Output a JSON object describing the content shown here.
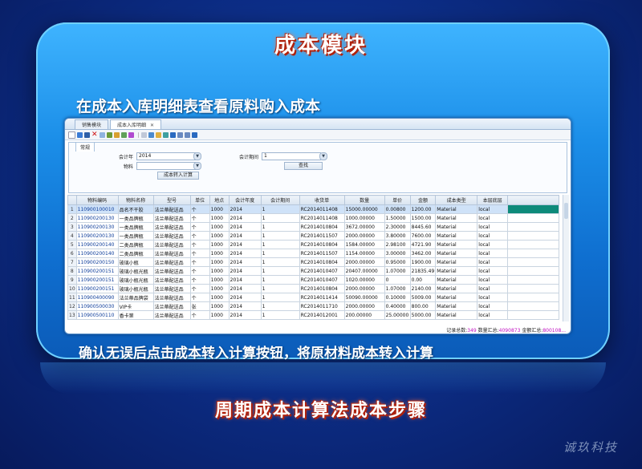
{
  "slide": {
    "title": "成本模块",
    "subtitle": "在成本入库明细表查看原料购入成本",
    "caption": "确认无误后点击成本转入计算按钮，将原材料成本转入计算",
    "bottom_title": "周期成本计算法成本步骤",
    "brand": "诚玖科技"
  },
  "app": {
    "tabs": [
      {
        "label": "销售模块"
      },
      {
        "label": "成本入库明细"
      }
    ],
    "filter_tab": "常规",
    "filters": {
      "fiscal_year_label": "会计年",
      "fiscal_year_value": "2014",
      "fiscal_period_label": "会计期间",
      "fiscal_period_value": "1",
      "material_label": "物料",
      "material_value": "",
      "transfer_button": "成本转入计算",
      "search_button": "查找"
    },
    "table": {
      "columns": [
        "物料编码",
        "物料名称",
        "型号",
        "单位",
        "地点",
        "会计年度",
        "会计期间",
        "收货单",
        "数量",
        "单价",
        "金额",
        "成本类型",
        "本层底层"
      ],
      "rows": [
        [
          "1",
          "110900100010",
          "品名不干胶",
          "法兰蒂配送品",
          "个",
          "1000",
          "2014",
          "1",
          "RC2014011408",
          "15000.00000",
          "0.00800",
          "1200.00",
          "Material",
          "local"
        ],
        [
          "2",
          "110900200130",
          "一类品牌瓶",
          "法兰蒂配送品",
          "个",
          "1000",
          "2014",
          "1",
          "RC2014011408",
          "1000.00000",
          "1.50000",
          "1500.00",
          "Material",
          "local"
        ],
        [
          "3",
          "110900200130",
          "一类品牌瓶",
          "法兰蒂配送品",
          "个",
          "1000",
          "2014",
          "1",
          "RC2014010804",
          "3672.00000",
          "2.30000",
          "8445.60",
          "Material",
          "local"
        ],
        [
          "4",
          "110900200130",
          "一类品牌瓶",
          "法兰蒂配送品",
          "个",
          "1000",
          "2014",
          "1",
          "RC2014011507",
          "2000.00000",
          "3.80000",
          "7600.00",
          "Material",
          "local"
        ],
        [
          "5",
          "110900200140",
          "二类品牌瓶",
          "法兰蒂配送品",
          "个",
          "1000",
          "2014",
          "1",
          "RC2014010804",
          "1584.00000",
          "2.98100",
          "4721.90",
          "Material",
          "local"
        ],
        [
          "6",
          "110900200140",
          "二类品牌瓶",
          "法兰蒂配送品",
          "个",
          "1000",
          "2014",
          "1",
          "RC2014011507",
          "1154.00000",
          "3.00000",
          "3462.00",
          "Material",
          "local"
        ],
        [
          "7",
          "110900200150",
          "玻璃小瓶",
          "法兰蒂配送品",
          "个",
          "1000",
          "2014",
          "1",
          "RC2014010804",
          "2000.00000",
          "0.95000",
          "1900.00",
          "Material",
          "local"
        ],
        [
          "8",
          "110900200151",
          "玻璃小瓶光瓶",
          "法兰蒂配送品",
          "个",
          "1000",
          "2014",
          "1",
          "RC2014010407",
          "20407.00000",
          "1.07000",
          "21835.49",
          "Material",
          "local"
        ],
        [
          "9",
          "110900200151",
          "玻璃小瓶光瓶",
          "法兰蒂配送品",
          "个",
          "1000",
          "2014",
          "1",
          "RC2014010407",
          "1020.00000",
          "0",
          "0.00",
          "Material",
          "local"
        ],
        [
          "10",
          "110900200151",
          "玻璃小瓶光瓶",
          "法兰蒂配送品",
          "个",
          "1000",
          "2014",
          "1",
          "RC2014010804",
          "2000.00000",
          "1.07000",
          "2140.00",
          "Material",
          "local"
        ],
        [
          "11",
          "110900400090",
          "法兰蒂品牌袋",
          "法兰蒂配送品",
          "个",
          "1000",
          "2014",
          "1",
          "RC2014011414",
          "50090.00000",
          "0.10000",
          "5009.00",
          "Material",
          "local"
        ],
        [
          "12",
          "110900500030",
          "VIP卡",
          "法兰蒂配送品",
          "张",
          "1000",
          "2014",
          "1",
          "RC2014011710",
          "2000.00000",
          "0.40000",
          "800.00",
          "Material",
          "local"
        ],
        [
          "13",
          "110900500110",
          "香卡第",
          "法兰蒂配送品",
          "个",
          "1000",
          "2014",
          "1",
          "RC2014012001",
          "200.00000",
          "25.00000",
          "5000.00",
          "Material",
          "local"
        ]
      ]
    },
    "status": {
      "records_label": "记录总数:",
      "records_value": "349",
      "qty_label": "数量汇总:",
      "qty_value": "4090873",
      "amount_label": "金额汇总:",
      "amount_value": "800108..."
    },
    "colors": {
      "selection": "#cfe2f8",
      "highlight_cell": "#0d8a7a",
      "status_value": "#c010c0"
    }
  }
}
